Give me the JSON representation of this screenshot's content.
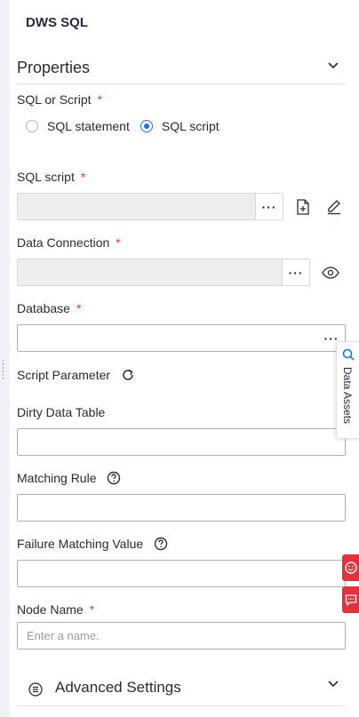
{
  "panel": {
    "title": "DWS SQL"
  },
  "properties": {
    "title": "Properties"
  },
  "sql_or_script": {
    "label": "SQL or Script",
    "required_mark": "*",
    "options": [
      {
        "label": "SQL statement",
        "checked": false
      },
      {
        "label": "SQL script",
        "checked": true
      }
    ]
  },
  "sql_script": {
    "label": "SQL script",
    "required_mark": "*",
    "value": "",
    "more": "···"
  },
  "data_connection": {
    "label": "Data Connection",
    "required_mark": "*",
    "value": "",
    "more": "···"
  },
  "database": {
    "label": "Database",
    "required_mark": "*",
    "value": "",
    "more": "···"
  },
  "script_parameter": {
    "label": "Script Parameter"
  },
  "dirty_data_table": {
    "label": "Dirty Data Table",
    "value": ""
  },
  "matching_rule": {
    "label": "Matching Rule",
    "value": ""
  },
  "failure_matching_value": {
    "label": "Failure Matching Value",
    "value": ""
  },
  "node_name": {
    "label": "Node Name",
    "required_mark": "*",
    "value": "",
    "placeholder": "Enter a name."
  },
  "data_assets": {
    "label": "Data Assets"
  },
  "advanced_settings": {
    "label": "Advanced Settings"
  },
  "colors": {
    "accent": "#1e6fff",
    "required": "#e43a3a",
    "feedback": "#e5313c"
  }
}
